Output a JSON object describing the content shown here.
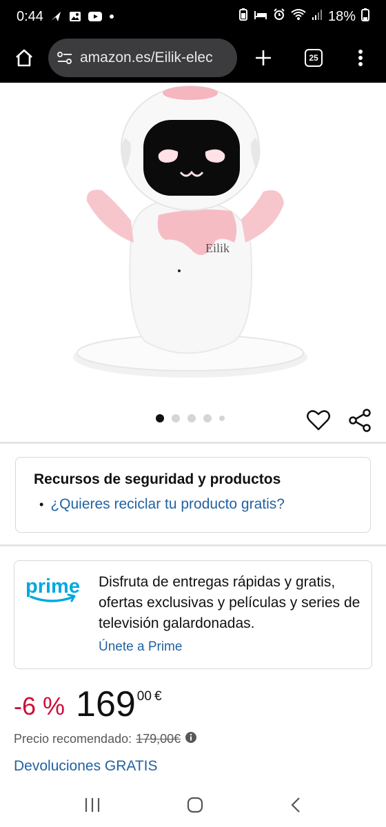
{
  "status_bar": {
    "time": "0:44",
    "battery": "18%"
  },
  "browser": {
    "url": "amazon.es/Eilik-elec",
    "tab_count": "25"
  },
  "product": {
    "image_label": "Eilik",
    "gallery": {
      "total_dots": 5,
      "active_index": 0
    }
  },
  "safety": {
    "title": "Recursos de seguridad y productos",
    "link": "¿Quieres reciclar tu producto gratis?"
  },
  "prime": {
    "logo_text": "prime",
    "description": "Disfruta de entregas rápidas y gratis, ofertas exclusivas y películas y series de televisión galardonadas.",
    "join_link": "Únete a Prime"
  },
  "pricing": {
    "discount": "-6 %",
    "price_whole": "169",
    "price_fraction": "00",
    "currency": "€",
    "rrp_label": "Precio recomendado:",
    "rrp_value": "179,00€"
  },
  "returns": "Devoluciones GRATIS",
  "colors": {
    "link": "#2162a1",
    "discount": "#cc0c39",
    "prime_blue": "#00a8e1"
  }
}
